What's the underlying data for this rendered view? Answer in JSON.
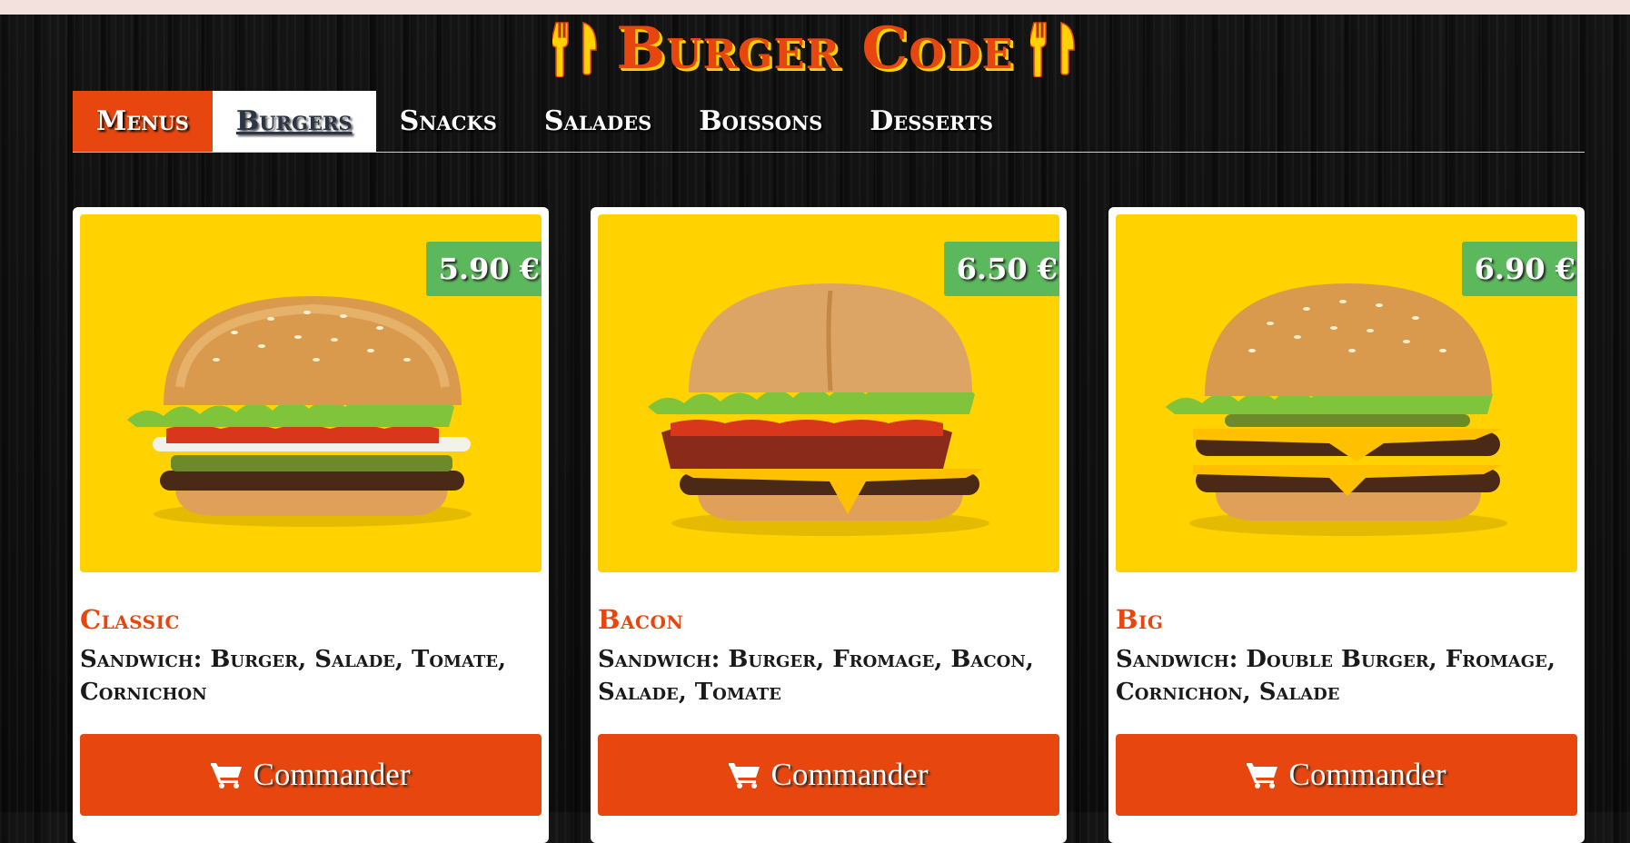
{
  "brand": {
    "title": "Burger Code",
    "accent": "#e7470f",
    "shadow": "#ffd200"
  },
  "nav": {
    "tabs": [
      {
        "label": "Menus"
      },
      {
        "label": "Burgers"
      },
      {
        "label": "Snacks"
      },
      {
        "label": "Salades"
      },
      {
        "label": "Boissons"
      },
      {
        "label": "Desserts"
      }
    ],
    "active": "Burgers"
  },
  "products": [
    {
      "name": "Classic",
      "description": "Sandwich: Burger, Salade, Tomate, Cornichon",
      "price": "5.90 €",
      "button": "Commander"
    },
    {
      "name": "Bacon",
      "description": "Sandwich: Burger, Fromage, Bacon, Salade, Tomate",
      "price": "6.50 €",
      "button": "Commander"
    },
    {
      "name": "Big",
      "description": "Sandwich: Double Burger, Fromage, Cornichon, Salade",
      "price": "6.90 €",
      "button": "Commander"
    }
  ],
  "colors": {
    "price_badge": "#5cb85c",
    "card_image_bg": "#ffd200",
    "button": "#e7470f"
  },
  "icons": {
    "cutlery": "fork-knife-icon",
    "cart": "shopping-cart-icon"
  }
}
